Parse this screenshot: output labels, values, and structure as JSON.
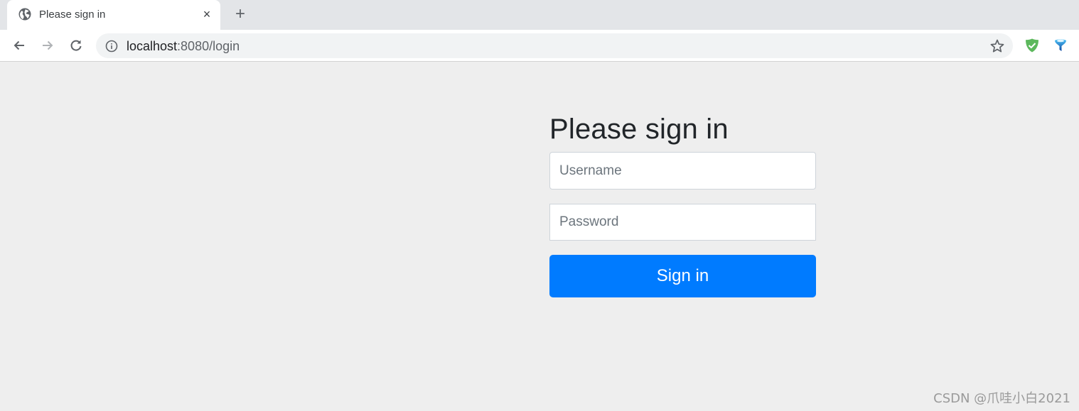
{
  "browser": {
    "tab": {
      "title": "Please sign in",
      "favicon": "globe-icon",
      "close_label": "×"
    },
    "new_tab_label": "+",
    "nav": {
      "back_icon": "arrow-left-icon",
      "forward_icon": "arrow-right-icon",
      "reload_icon": "reload-icon"
    },
    "address_bar": {
      "host": "localhost",
      "rest": ":8080/login",
      "info_icon": "info-icon",
      "bookmark_icon": "star-icon"
    },
    "extensions": [
      {
        "name": "shield-check-icon",
        "color": "#4caf50"
      },
      {
        "name": "funnel-extension-icon",
        "color": "#1565c0"
      }
    ]
  },
  "login": {
    "heading": "Please sign in",
    "username": {
      "placeholder": "Username",
      "value": ""
    },
    "password": {
      "placeholder": "Password",
      "value": ""
    },
    "submit_label": "Sign in",
    "accent_color": "#007bff"
  },
  "watermark": "CSDN @爪哇小白2021"
}
